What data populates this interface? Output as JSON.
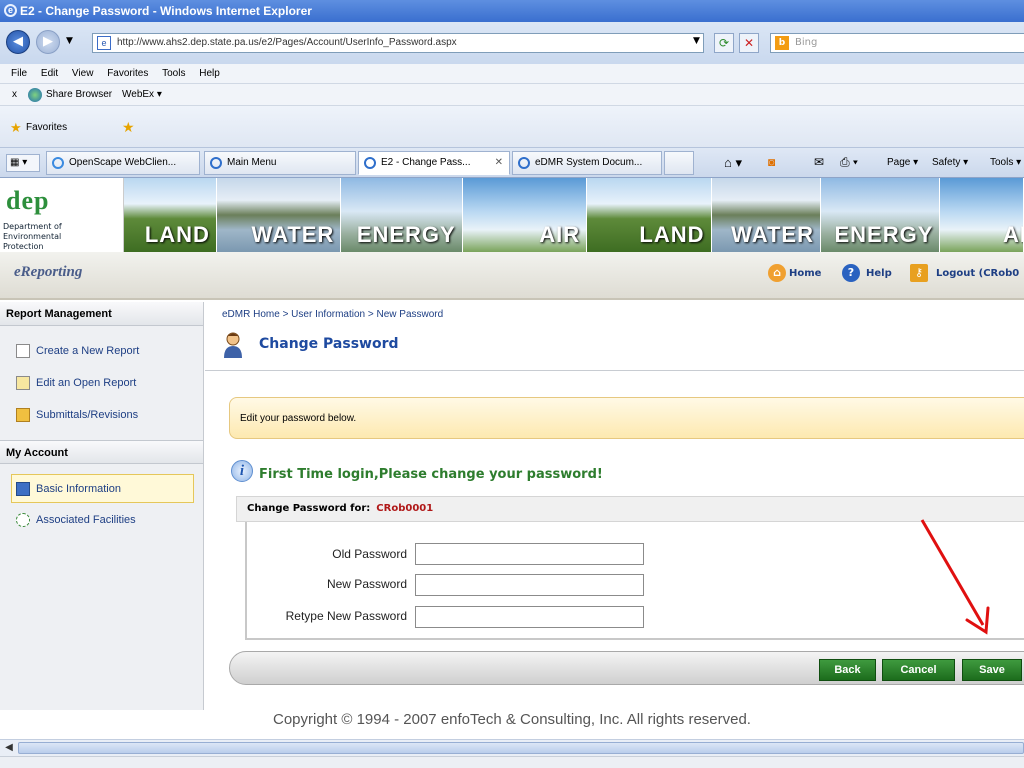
{
  "window": {
    "title": "E2 - Change Password - Windows Internet Explorer"
  },
  "address": {
    "url": "http://www.ahs2.dep.state.pa.us/e2/Pages/Account/UserInfo_Password.aspx",
    "search_placeholder": "Bing"
  },
  "menu": {
    "items": [
      "File",
      "Edit",
      "View",
      "Favorites",
      "Tools",
      "Help"
    ]
  },
  "toolbar": {
    "close": "x",
    "share_browser": "Share Browser",
    "webex": "WebEx ▾"
  },
  "favorites": {
    "label": "Favorites"
  },
  "tabs": [
    {
      "label": "OpenScape WebClien..."
    },
    {
      "label": "Main Menu"
    },
    {
      "label": "E2 - Change Pass..."
    },
    {
      "label": "eDMR System Docum..."
    }
  ],
  "command_bar": {
    "page": "Page ▾",
    "safety": "Safety ▾",
    "tools": "Tools ▾"
  },
  "banner": {
    "logo_text": "dep",
    "logo_sub": "Department of Environmental Protection",
    "tiles": [
      "LAND",
      "WATER",
      "ENERGY",
      "AIR",
      "LAND",
      "WATER",
      "ENERGY",
      "AI"
    ]
  },
  "header": {
    "app_name": "eReporting",
    "home": "Home",
    "help": "Help",
    "logout": "Logout (CRob0"
  },
  "sidebar": {
    "report_management": "Report Management",
    "items": [
      "Create a New Report",
      "Edit an Open Report",
      "Submittals/Revisions"
    ],
    "my_account": "My Account",
    "account_items": [
      "Basic Information",
      "Associated Facilities"
    ]
  },
  "main": {
    "breadcrumb": "eDMR Home > User Information > New Password",
    "title": "Change Password",
    "note": "Edit your password below.",
    "first_login": "First Time login,Please change your password!",
    "change_for_label": "Change Password for:",
    "user_id": "CRob0001",
    "fields": {
      "old": "Old Password",
      "new": "New Password",
      "retype": "Retype New Password"
    },
    "buttons": {
      "back": "Back",
      "cancel": "Cancel",
      "save": "Save"
    }
  },
  "footer": {
    "copyright": "Copyright © 1994 - 2007 enfoTech & Consulting, Inc. All rights reserved."
  },
  "colors": {
    "accent_green": "#2e7d2e",
    "link_blue": "#1e3f84",
    "annotation_red": "#e01010"
  }
}
